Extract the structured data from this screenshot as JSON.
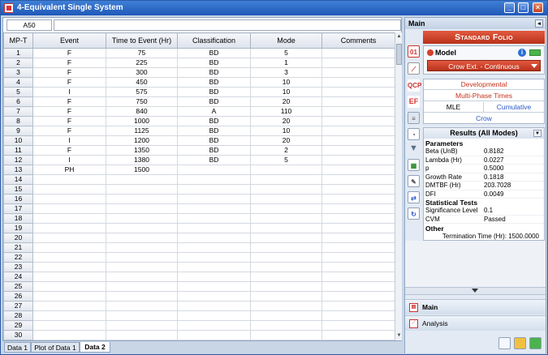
{
  "window": {
    "title": "4-Equivalent Single System",
    "minimize": "_",
    "maximize": "□",
    "close": "×"
  },
  "sheet": {
    "cell_ref": "A50",
    "columns": [
      "MP-T",
      "Event",
      "Time to Event (Hr)",
      "Classification",
      "Mode",
      "Comments"
    ],
    "rows": [
      {
        "n": "1",
        "event": "F",
        "time": "75",
        "cls": "BD",
        "mode": "5"
      },
      {
        "n": "2",
        "event": "F",
        "time": "225",
        "cls": "BD",
        "mode": "1"
      },
      {
        "n": "3",
        "event": "F",
        "time": "300",
        "cls": "BD",
        "mode": "3"
      },
      {
        "n": "4",
        "event": "F",
        "time": "450",
        "cls": "BD",
        "mode": "10"
      },
      {
        "n": "5",
        "event": "I",
        "time": "575",
        "cls": "BD",
        "mode": "10"
      },
      {
        "n": "6",
        "event": "F",
        "time": "750",
        "cls": "BD",
        "mode": "20"
      },
      {
        "n": "7",
        "event": "F",
        "time": "840",
        "cls": "A",
        "mode": "110"
      },
      {
        "n": "8",
        "event": "F",
        "time": "1000",
        "cls": "BD",
        "mode": "20"
      },
      {
        "n": "9",
        "event": "F",
        "time": "1125",
        "cls": "BD",
        "mode": "10"
      },
      {
        "n": "10",
        "event": "I",
        "time": "1200",
        "cls": "BD",
        "mode": "20"
      },
      {
        "n": "11",
        "event": "F",
        "time": "1350",
        "cls": "BD",
        "mode": "2"
      },
      {
        "n": "12",
        "event": "I",
        "time": "1380",
        "cls": "BD",
        "mode": "5"
      },
      {
        "n": "13",
        "event": "PH",
        "time": "1500",
        "cls": "",
        "mode": ""
      },
      {
        "n": "14"
      },
      {
        "n": "15"
      },
      {
        "n": "16"
      },
      {
        "n": "17"
      },
      {
        "n": "18"
      },
      {
        "n": "19"
      },
      {
        "n": "20"
      },
      {
        "n": "21"
      },
      {
        "n": "22"
      },
      {
        "n": "23"
      },
      {
        "n": "24"
      },
      {
        "n": "25"
      },
      {
        "n": "26"
      },
      {
        "n": "27"
      },
      {
        "n": "28"
      },
      {
        "n": "29"
      },
      {
        "n": "30"
      }
    ]
  },
  "tabs": [
    "Data 1",
    "Plot of Data 1",
    "Data 2"
  ],
  "panel": {
    "header": "Main",
    "folio": "Standard Folio",
    "model_title": "Model",
    "model_value": "Crow Ext. - Continuous",
    "options": {
      "developmental": "Developmental",
      "multiphase": "Multi-Phase Times",
      "mle": "MLE",
      "cumulative": "Cumulative",
      "crow": "Crow"
    },
    "results_header": "Results (All Modes)",
    "parameters_label": "Parameters",
    "parameters": [
      {
        "k": "Beta (UnB)",
        "v": "0.8182"
      },
      {
        "k": "Lambda (Hr)",
        "v": "0.0227"
      },
      {
        "k": "p",
        "v": "0.5000"
      },
      {
        "k": "Growth Rate",
        "v": "0.1818"
      },
      {
        "k": "DMTBF (Hr)",
        "v": "203.7028"
      },
      {
        "k": "DFI",
        "v": "0.0049"
      }
    ],
    "stats_label": "Statistical Tests",
    "stats": [
      {
        "k": "Significance Level",
        "v": "0.1"
      },
      {
        "k": "CVM",
        "v": "Passed"
      }
    ],
    "other_label": "Other",
    "termination": "Termination Time (Hr): 1500.0000",
    "nav_main": "Main",
    "nav_analysis": "Analysis"
  },
  "colors": {
    "accent_red": "#c8321c",
    "title_blue": "#1f58b8",
    "link_blue": "#2a56c6"
  }
}
